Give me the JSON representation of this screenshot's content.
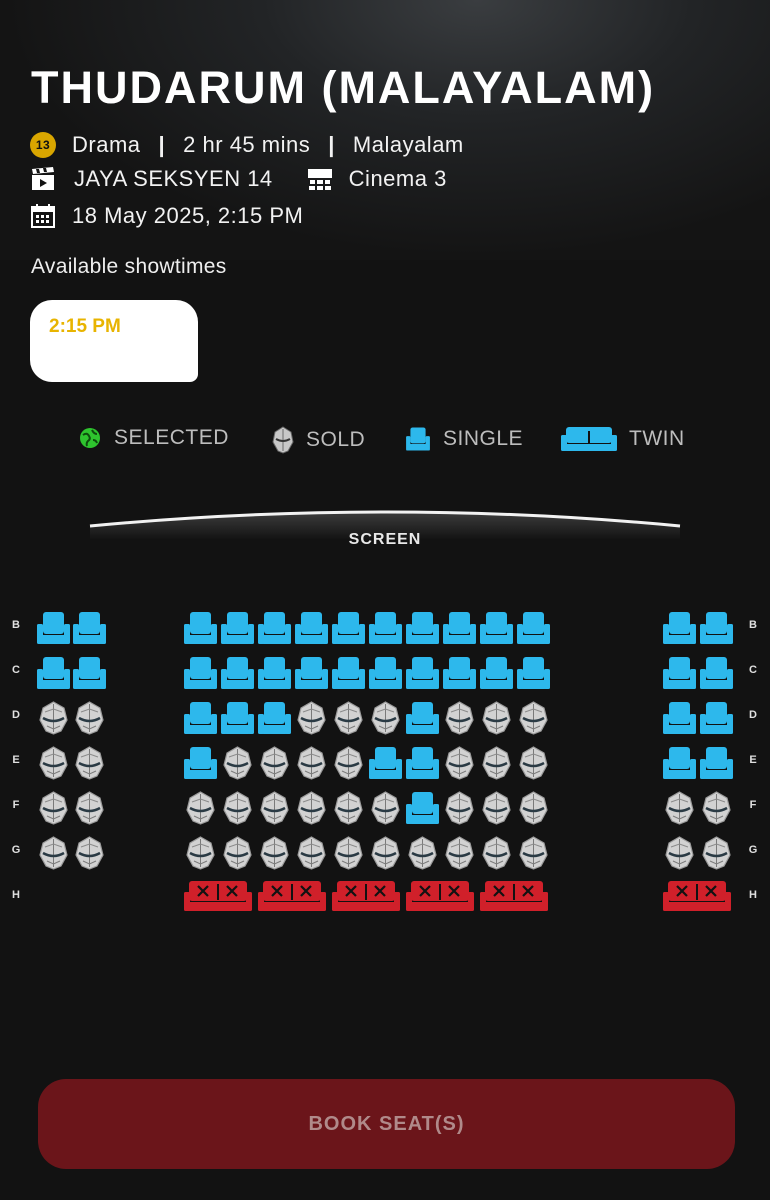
{
  "movie": {
    "title": "THUDARUM (MALAYALAM)",
    "rating_badge": "13",
    "genre": "Drama",
    "duration": "2 hr 45 mins",
    "language": "Malayalam",
    "cinema": "JAYA SEKSYEN 14",
    "hall": "Cinema 3",
    "datetime": "18 May 2025, 2:15 PM"
  },
  "separator": "|",
  "showtimes": {
    "label": "Available showtimes",
    "items": [
      "2:15 PM"
    ]
  },
  "legend": {
    "selected": "SELECTED",
    "sold": "SOLD",
    "single": "SINGLE",
    "twin": "TWIN"
  },
  "screen_label": "SCREEN",
  "rows": [
    "B",
    "C",
    "D",
    "E",
    "F",
    "G",
    "H"
  ],
  "seat_map": {
    "left": {
      "B": [
        "A",
        "A"
      ],
      "C": [
        "A",
        "A"
      ],
      "D": [
        "S",
        "S"
      ],
      "E": [
        "S",
        "S"
      ],
      "F": [
        "S",
        "S"
      ],
      "G": [
        "S",
        "S"
      ]
    },
    "center": {
      "B": [
        "A",
        "A",
        "A",
        "A",
        "A",
        "A",
        "A",
        "A",
        "A",
        "A"
      ],
      "C": [
        "A",
        "A",
        "A",
        "A",
        "A",
        "A",
        "A",
        "A",
        "A",
        "A"
      ],
      "D": [
        "A",
        "A",
        "A",
        "S",
        "S",
        "S",
        "A",
        "S",
        "S",
        "S"
      ],
      "E": [
        "A",
        "S",
        "S",
        "S",
        "S",
        "A",
        "A",
        "S",
        "S",
        "S"
      ],
      "F": [
        "S",
        "S",
        "S",
        "S",
        "S",
        "S",
        "A",
        "S",
        "S",
        "S"
      ],
      "G": [
        "S",
        "S",
        "S",
        "S",
        "S",
        "S",
        "S",
        "S",
        "S",
        "S"
      ]
    },
    "right": {
      "B": [
        "A",
        "A"
      ],
      "C": [
        "A",
        "A"
      ],
      "D": [
        "A",
        "A"
      ],
      "E": [
        "A",
        "A"
      ],
      "F": [
        "S",
        "S"
      ],
      "G": [
        "S",
        "S"
      ]
    },
    "twin_row": {
      "row": "H",
      "center_count": 5,
      "right_count": 1,
      "status": "unavailable"
    }
  },
  "colors": {
    "available": "#2db8ec",
    "twin_unavailable": "#d0202a",
    "selected": "#2ec42e",
    "sold": "#9a9a9a",
    "book_button": "#6b151a",
    "showtime_text": "#e8b400"
  },
  "book_button": "BOOK SEAT(S)"
}
